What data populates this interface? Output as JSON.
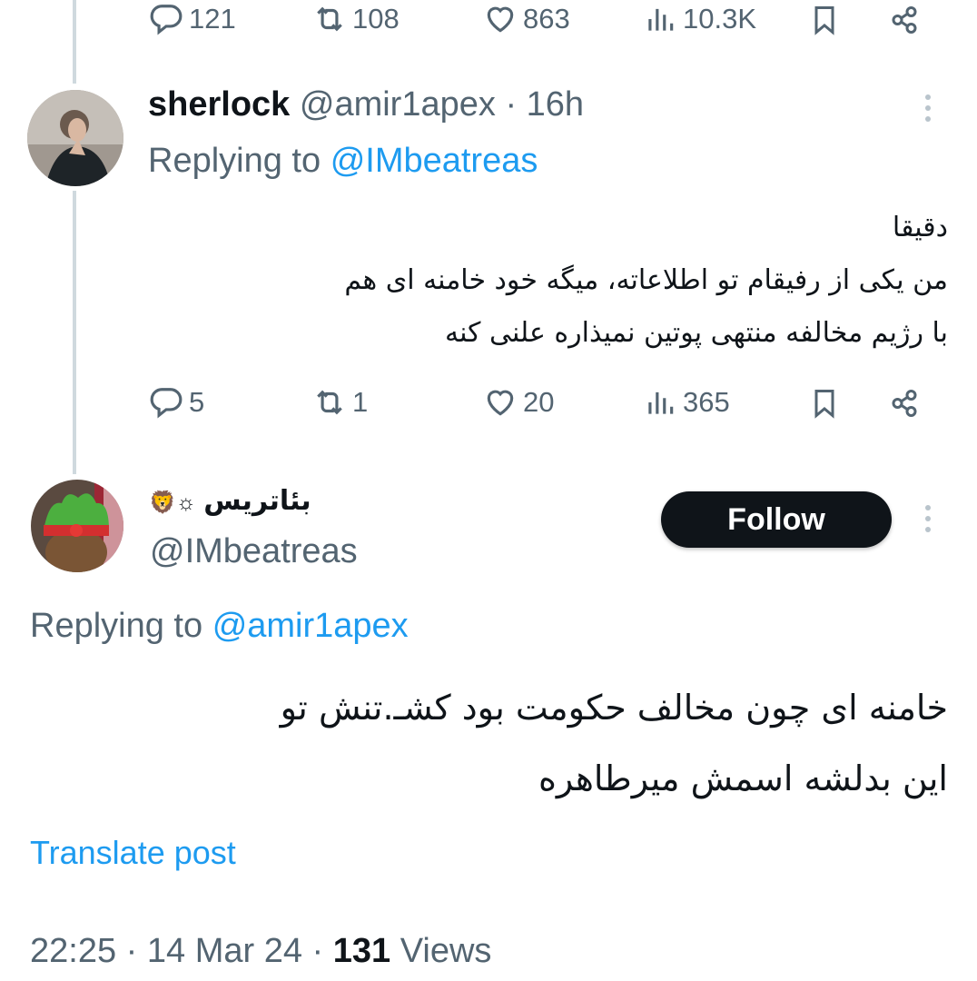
{
  "top_actions": {
    "replies": "121",
    "reposts": "108",
    "likes": "863",
    "views": "10.3K"
  },
  "reply1": {
    "name": "sherlock",
    "handle": "@amir1apex",
    "separator": "·",
    "time": "16h",
    "replying_label": "Replying to",
    "replying_to": "@IMbeatreas",
    "text_lines": [
      "دقیقا",
      "من یکی از رفیقام تو اطلاعاته، میگه خود خامنه ای هم",
      "با رژیم مخالفه منتهی پوتین نمیذاره علنی کنه"
    ],
    "actions": {
      "replies": "5",
      "reposts": "1",
      "likes": "20",
      "views": "365"
    }
  },
  "main_post": {
    "name": "بئاتریس",
    "name_emoji": "☼🦁",
    "handle": "@IMbeatreas",
    "follow_label": "Follow",
    "replying_label": "Replying to",
    "replying_to": "@amir1apex",
    "text_lines": [
      "خامنه ای چون مخالف حکومت بود کشـ.تنش تو",
      "این بدلشه اسمش میرطاهره"
    ],
    "translate_label": "Translate post",
    "time": "22:25",
    "date": "14 Mar 24",
    "views_count": "131",
    "views_label": "Views"
  },
  "icons": [
    "reply-icon",
    "repost-icon",
    "like-icon",
    "views-icon",
    "bookmark-icon",
    "share-icon",
    "more-icon"
  ]
}
